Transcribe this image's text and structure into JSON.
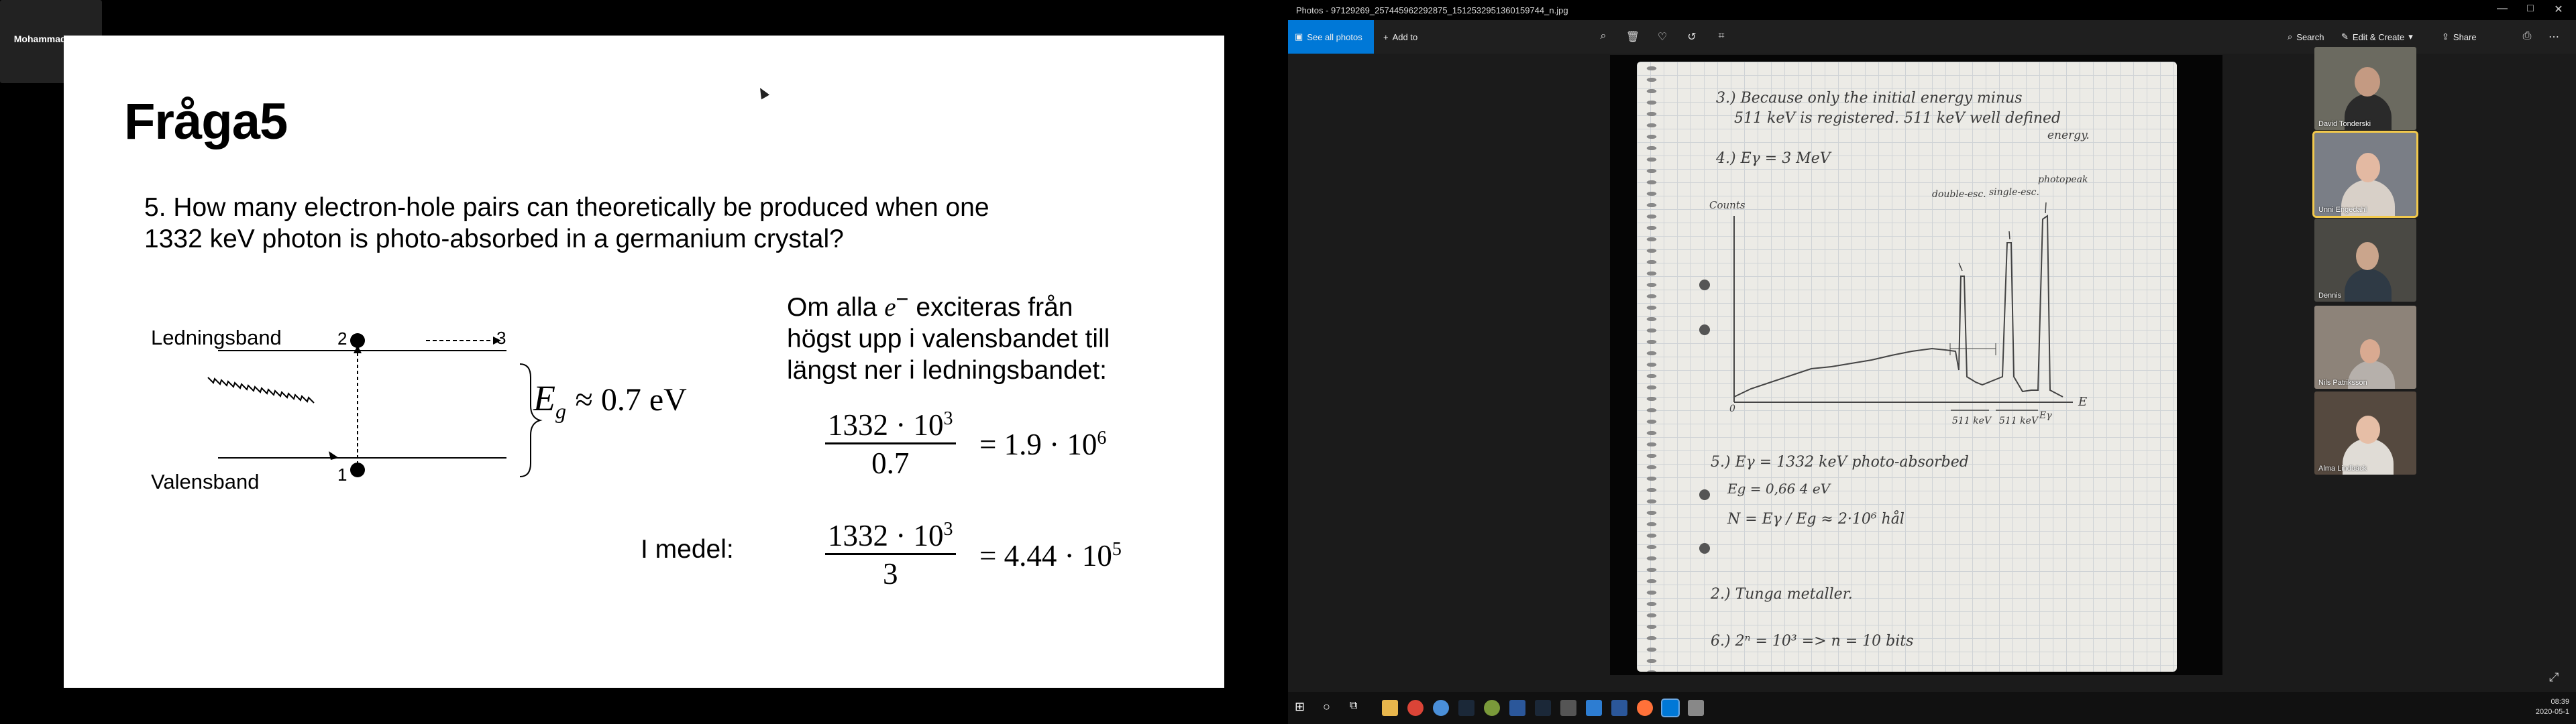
{
  "slide": {
    "title": "Fråga5",
    "question_line1": "5. How many electron-hole pairs can theoretically be produced when one",
    "question_line2": "1332 keV photon is photo-absorbed in a germanium crystal?",
    "ledningsband": "Ledningsband",
    "valensband": "Valensband",
    "level_1": "1",
    "level_2": "2",
    "level_3": "3",
    "eg_label": "E",
    "eg_sub": "g",
    "eg_value": "≈ 0.7 eV",
    "right_text_1": "Om alla",
    "right_text_e": "e",
    "right_text_sup": "−",
    "right_text_2": "exciteras från",
    "right_text_line2": "högst upp i valensbandet till",
    "right_text_line3": "längst ner i ledningsbandet:",
    "frac1_num": "1332 · 10",
    "frac1_num_exp": "3",
    "frac1_den": "0.7",
    "frac1_rhs": "= 1.9 · 10",
    "frac1_rhs_exp": "6",
    "i_medel": "I medel:",
    "frac2_num": "1332 · 10",
    "frac2_num_exp": "3",
    "frac2_den": "3",
    "frac2_rhs": "= 4.44 · 10",
    "frac2_rhs_exp": "5"
  },
  "photos_app": {
    "window_title": "Photos - 97129269_257445962292875_1512532951360159744_n.jpg",
    "window_controls": [
      "—",
      "□",
      "✕"
    ],
    "toolbar": {
      "see_all": "See all photos",
      "add_to": "Add to",
      "search": "Search",
      "edit_create": "Edit & Create",
      "share": "Share"
    },
    "icons": [
      "zoom-icon",
      "delete-icon",
      "favorite-icon",
      "rotate-icon",
      "crop-icon",
      "print-icon",
      "more-icon"
    ]
  },
  "notes": {
    "l1": "3.)  Because only the initial energy minus",
    "l2": "511 keV is registered. 511 keV well defined",
    "l3": "energy.",
    "l4": "4.)   Eγ = 3 MeV",
    "counts": "Counts",
    "double": "double-esc.",
    "single": "single-esc.",
    "photopeak": "photopeak",
    "axis_e": "E",
    "axis_0": "0",
    "dist1": "511 keV",
    "dist2": "511 keV",
    "eg": "Eγ",
    "l5": "5.)  Eγ = 1332 keV  photo-absorbed",
    "l6": "Eg = 0,66 4  eV",
    "l7": "N = Eγ / Eg  ≈ 2·10⁶  hål",
    "l8": "2.)  Tunga metaller.",
    "l9": "6.)   2ⁿ = 10³        =>   n = 10 bits"
  },
  "participants": [
    {
      "name": "David Tonderski",
      "bg": "#6b6a60"
    },
    {
      "name": "Unni Engedahl",
      "bg": "#7a7e86"
    },
    {
      "name": "Dennis",
      "bg": "#4a4944"
    },
    {
      "name": "Nils Patriksson",
      "bg": "#8d8379"
    },
    {
      "name": "Alma Lindbäck",
      "bg": "#55493f"
    }
  ],
  "active_speaker": "Mohammad Zo...",
  "tray": {
    "time": "08:39",
    "date": "2020-05-1"
  },
  "colors": {
    "accent": "#0078d7",
    "active_border": "#f2c94c"
  }
}
